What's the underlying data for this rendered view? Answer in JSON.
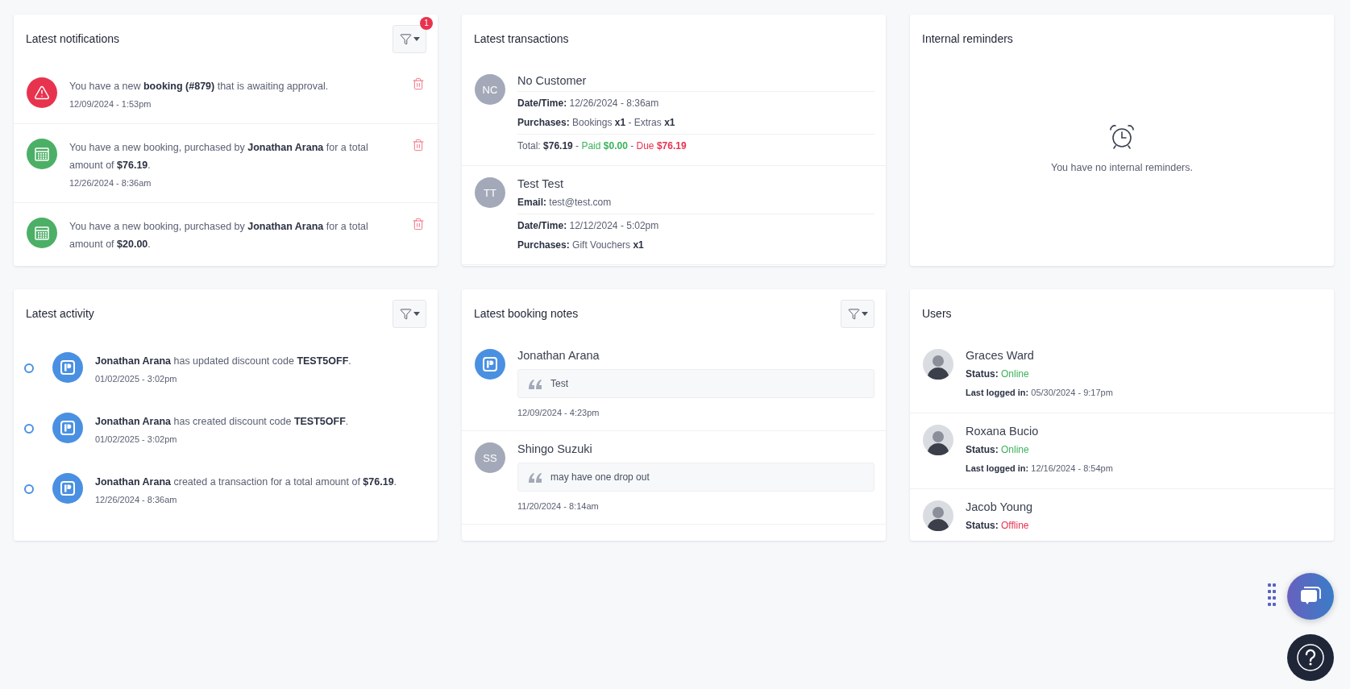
{
  "notifications": {
    "title": "Latest notifications",
    "filter_badge": "1",
    "items": [
      {
        "kind": "warning",
        "text": "You have a new **booking (#879)** that is awaiting approval.",
        "time": "12/09/2024 - 1:53pm"
      },
      {
        "kind": "booking",
        "text": "You have a new booking, purchased by **Jonathan Arana** for a total amount of **$76.19**.",
        "time": "12/26/2024 - 8:36am"
      },
      {
        "kind": "booking",
        "text": "You have a new booking, purchased by **Jonathan Arana** for a total amount of **$20.00**."
      }
    ]
  },
  "transactions": {
    "title": "Latest transactions",
    "items": [
      {
        "initials": "NC",
        "name": "No Customer",
        "fields": [
          {
            "label": "Date/Time:",
            "value": "12/26/2024 - 8:36am"
          },
          {
            "label": "Purchases:",
            "value": "Bookings **x1** - Extras **x1**"
          }
        ],
        "separator": "-",
        "amounts": [
          {
            "kind": "total",
            "label": "Total:",
            "amount": "$76.19"
          },
          {
            "kind": "paid",
            "label": "Paid",
            "amount": "$0.00"
          },
          {
            "kind": "due",
            "label": "Due",
            "amount": "$76.19"
          }
        ]
      },
      {
        "initials": "TT",
        "name": "Test Test",
        "email": {
          "label": "Email:",
          "value": "test@test.com"
        },
        "fields": [
          {
            "label": "Date/Time:",
            "value": "12/12/2024 - 5:02pm"
          },
          {
            "label": "Purchases:",
            "value": "Gift Vouchers **x1**"
          }
        ]
      }
    ]
  },
  "reminders": {
    "title": "Internal reminders",
    "empty_text": "You have no internal reminders."
  },
  "activity": {
    "title": "Latest activity",
    "items": [
      {
        "text": "**Jonathan Arana** has updated discount code **TEST5OFF**.",
        "time": "01/02/2025 - 3:02pm"
      },
      {
        "text": "**Jonathan Arana** has created discount code **TEST5OFF**.",
        "time": "01/02/2025 - 3:02pm"
      },
      {
        "text": "**Jonathan Arana** created a transaction for a total amount of **$76.19**.",
        "time": "12/26/2024 - 8:36am"
      }
    ]
  },
  "booking_notes": {
    "title": "Latest booking notes",
    "items": [
      {
        "kind": "logo",
        "author": "Jonathan Arana",
        "note": "Test",
        "time": "12/09/2024 - 4:23pm"
      },
      {
        "kind": "initials",
        "initials": "SS",
        "author": "Shingo Suzuki",
        "note": "may have one drop out",
        "time": "11/20/2024 - 8:14am"
      }
    ]
  },
  "users": {
    "title": "Users",
    "items": [
      {
        "name": "Graces Ward",
        "status_label": "Status:",
        "status": "Online",
        "online": true,
        "last_label": "Last logged in:",
        "last_value": "05/30/2024 - 9:17pm"
      },
      {
        "name": "Roxana Bucio",
        "status_label": "Status:",
        "status": "Online",
        "online": true,
        "last_label": "Last logged in:",
        "last_value": "12/16/2024 - 8:54pm"
      },
      {
        "name": "Jacob Young",
        "status_label": "Status:",
        "status": "Offline",
        "online": false
      }
    ]
  }
}
